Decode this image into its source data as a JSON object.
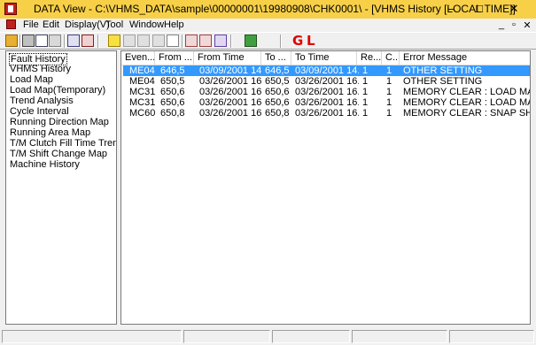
{
  "window": {
    "title": "DATA View - C:\\VHMS_DATA\\sample\\00000001\\19980908\\CHK0001\\ - [VHMS History   [LOCAL TIME]]",
    "minimize": "–",
    "maximize": "□",
    "close": "✕"
  },
  "menu": {
    "items": [
      "File",
      "Edit",
      "Display(V)",
      "Tool",
      "Window",
      "Help"
    ],
    "mdi_minimize": "_",
    "mdi_restore": "▫",
    "mdi_close": "✕"
  },
  "toolbar": {
    "g_label": "G",
    "l_label": "L",
    "icons": [
      "open-folder-icon",
      "print-icon",
      "print-preview-icon",
      "find-icon",
      "import-icon",
      "tools-icon",
      "add-icon",
      "copy-icon",
      "paste-icon",
      "grid-icon",
      "refresh-icon",
      "export-icon",
      "check-icon",
      "flag-icon"
    ]
  },
  "tree": {
    "items": [
      "Fault History",
      "VHMS History",
      "Load Map",
      "Load Map(Temporary)",
      "Trend Analysis",
      "Cycle Interval",
      "Running Direction Map",
      "Running Area Map",
      "T/M Clutch Fill Time Trend",
      "T/M Shift Change Map",
      "Machine History"
    ],
    "selected_index": 0
  },
  "grid": {
    "columns": [
      "Even...",
      "From ...",
      "From Time",
      "To ...",
      "To Time",
      "Re...",
      "C...",
      "Error Message"
    ],
    "rows": [
      [
        "ME04",
        "646,5",
        "03/09/2001 14...",
        "646,5",
        "03/09/2001 14...",
        "1",
        "1",
        "OTHER SETTING"
      ],
      [
        "ME04",
        "650,5",
        "03/26/2001 16...",
        "650,5",
        "03/26/2001 16...",
        "1",
        "1",
        "OTHER SETTING"
      ],
      [
        "MC31",
        "650,6",
        "03/26/2001 16...",
        "650,6",
        "03/26/2001 16...",
        "1",
        "1",
        "MEMORY CLEAR : LOAD MAP..."
      ],
      [
        "MC31",
        "650,6",
        "03/26/2001 16...",
        "650,6",
        "03/26/2001 16...",
        "1",
        "1",
        "MEMORY CLEAR : LOAD MAP..."
      ],
      [
        "MC60",
        "650,8",
        "03/26/2001 16...",
        "650,8",
        "03/26/2001 16...",
        "1",
        "1",
        "MEMORY CLEAR : SNAP SHOT"
      ]
    ],
    "selected_row": 0
  }
}
